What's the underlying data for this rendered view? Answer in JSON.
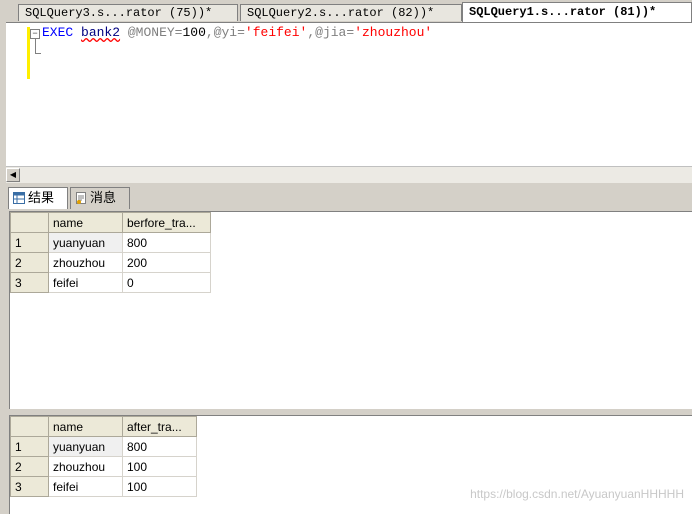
{
  "tabs": [
    {
      "label": "SQLQuery3.s...rator (75))*",
      "active": false
    },
    {
      "label": "SQLQuery2.s...rator (82))*",
      "active": false
    },
    {
      "label": "SQLQuery1.s...rator (81))*",
      "active": true
    }
  ],
  "editor": {
    "kw_exec": "EXEC",
    "proc": "bank2",
    "p1_name": "@MONEY",
    "eq": "=",
    "p1_val": "100",
    "comma": ",",
    "p2_name": "@yi",
    "p2_val": "'feifei'",
    "p3_name": "@jia",
    "p3_val": "'zhouzhou'"
  },
  "result_tabs": {
    "results_label": "结果",
    "messages_label": "消息"
  },
  "grid1": {
    "headers": [
      "name",
      "berfore_tra..."
    ],
    "rows": [
      {
        "n": "1",
        "name": "yuanyuan",
        "val": "800"
      },
      {
        "n": "2",
        "name": "zhouzhou",
        "val": "200"
      },
      {
        "n": "3",
        "name": "feifei",
        "val": "0"
      }
    ]
  },
  "grid2": {
    "headers": [
      "name",
      "after_tra..."
    ],
    "rows": [
      {
        "n": "1",
        "name": "yuanyuan",
        "val": "800"
      },
      {
        "n": "2",
        "name": "zhouzhou",
        "val": "100"
      },
      {
        "n": "3",
        "name": "feifei",
        "val": "100"
      }
    ]
  },
  "watermark": "https://blog.csdn.net/AyuanyuanHHHHH"
}
